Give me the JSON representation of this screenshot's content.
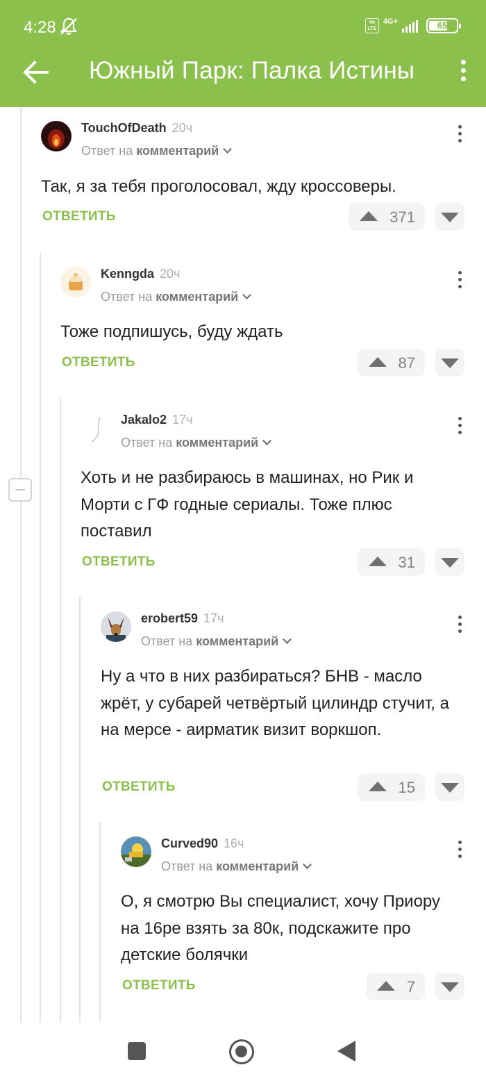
{
  "status_bar": {
    "time": "4:28",
    "network": "4G+",
    "volte": "Vo LTE",
    "battery": "65"
  },
  "header": {
    "title": "Южный Парк: Палка Истины"
  },
  "colors": {
    "accent": "#8ac04b",
    "text": "#222222",
    "muted": "#9b9b9b"
  },
  "comments": [
    {
      "author": "TouchOfDeath",
      "time": "20ч",
      "reply_prefix": "Ответ на",
      "reply_target": "комментарий",
      "text": "Так, я за тебя проголосовал, жду кроссоверы.",
      "reply_label": "ОТВЕТИТЬ",
      "votes": "371",
      "avatar_icon": "fire-avatar-icon"
    },
    {
      "author": "Kenngda",
      "time": "20ч",
      "reply_prefix": "Ответ на",
      "reply_target": "комментарий",
      "text": "Тоже подпишусь, буду ждать",
      "reply_label": "ОТВЕТИТЬ",
      "votes": "87",
      "avatar_icon": "cake-avatar-icon"
    },
    {
      "author": "Jakalo2",
      "time": "17ч",
      "reply_prefix": "Ответ на",
      "reply_target": "комментарий",
      "text": "Хоть и не разбираюсь в машинах, но Рик и Морти с ГФ годные сериалы. Тоже плюс поставил",
      "reply_label": "ОТВЕТИТЬ",
      "votes": "31",
      "avatar_icon": "sketch-avatar-icon"
    },
    {
      "author": "erobert59",
      "time": "17ч",
      "reply_prefix": "Ответ на",
      "reply_target": "комментарий",
      "text": "Ну а что в них разбираться? БНВ - масло жрёт, у субарей четвёртый цилиндр стучит, а на мерсе - аирматик визит воркшоп.",
      "reply_label": "ОТВЕТИТЬ",
      "votes": "15",
      "avatar_icon": "dog-avatar-icon"
    },
    {
      "author": "Curved90",
      "time": "16ч",
      "reply_prefix": "Ответ на",
      "reply_target": "комментарий",
      "text": "О, я смотрю Вы специалист, хочу Приору на 16ре взять за 80к, подскажите про детские болячки",
      "reply_label": "ОТВЕТИТЬ",
      "votes": "7",
      "avatar_icon": "landscape-avatar-icon"
    }
  ]
}
